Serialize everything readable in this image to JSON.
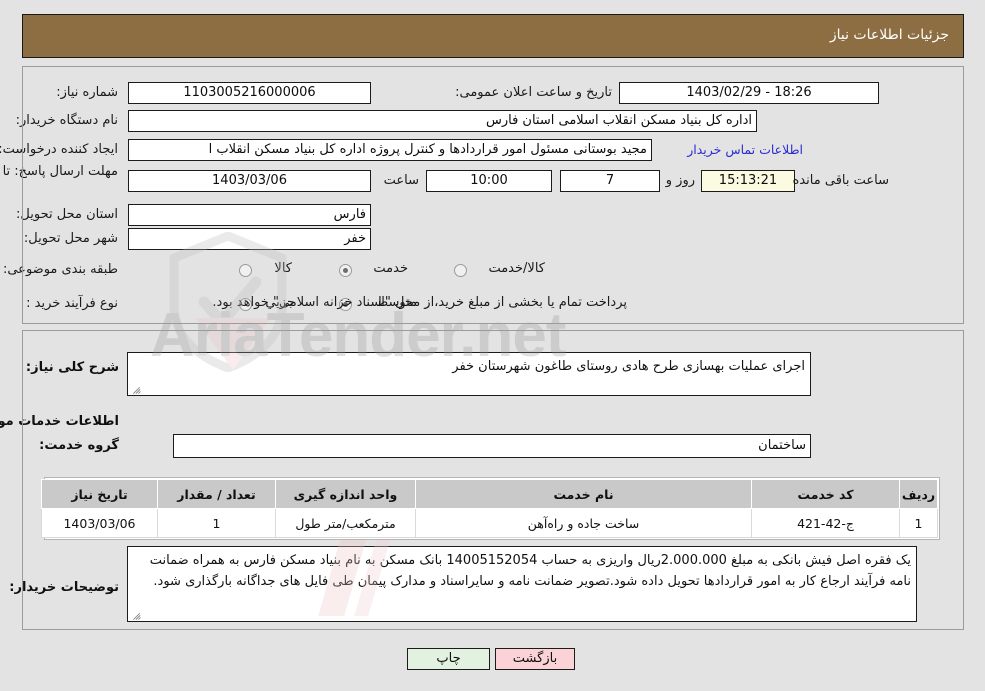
{
  "header": {
    "title": "جزئیات اطلاعات نیاز"
  },
  "form": {
    "need_number_label": "شماره نیاز:",
    "need_number_value": "1103005216000006",
    "announce_label": "تاریخ و ساعت اعلان عمومی:",
    "announce_value": "18:26 - 1403/02/29",
    "buyer_org_label": "نام دستگاه خریدار:",
    "buyer_org_value": "اداره کل بنیاد مسکن انقلاب اسلامی استان فارس",
    "creator_label": "ایجاد کننده درخواست:",
    "creator_value": "مجید بوستانی مسئول امور قراردادها و کنترل پروژه اداره کل بنیاد مسکن انقلاب ا",
    "contact_link": "اطلاعات تماس خریدار",
    "deadline_label": "مهلت ارسال پاسخ: تا تاریخ:",
    "deadline_date": "1403/03/06",
    "hour_label": "ساعت",
    "hour_value": "10:00",
    "days_value": "7",
    "days_label": "روز و",
    "timer_value": "15:13:21",
    "remaining_label": "ساعت باقی مانده",
    "province_label": "استان محل تحویل:",
    "province_value": "فارس",
    "city_label": "شهر محل تحویل:",
    "city_value": "خفر",
    "category_label": "طبقه بندی موضوعی:",
    "category_options": [
      {
        "label": "کالا",
        "selected": false
      },
      {
        "label": "خدمت",
        "selected": true
      },
      {
        "label": "کالا/خدمت",
        "selected": false
      }
    ],
    "process_label": "نوع فرآیند خرید :",
    "process_options": [
      {
        "label": "جزیي",
        "selected": false
      },
      {
        "label": "متوسط",
        "selected": true
      }
    ],
    "treasury_note": "پرداخت تمام یا بخشی از مبلغ خرید،از محل \"اسناد خزانه اسلامی\" خواهد بود."
  },
  "lower": {
    "general_desc_label": "شرح کلی نیاز:",
    "general_desc_value": "اجرای عملیات بهسازی طرح هادی روستای طاغون شهرستان خفر",
    "services_section_title": "اطلاعات خدمات مورد نیاز",
    "service_group_label": "گروه خدمت:",
    "service_group_value": "ساختمان",
    "buyer_notes_label": "توضیحات خریدار:",
    "buyer_notes_value": "یک فقره اصل فیش بانکی به مبلغ 2.000.000ریال واریزی به حساب 14005152054 بانک مسکن به نام بنیاد مسکن فارس به همراه ضمانت نامه فرآیند ارجاع کار به امور قراردادها تحویل داده شود.تصویر ضمانت نامه و سایراسناد و مدارک پیمان طی فایل های جداگانه بارگذاری شود."
  },
  "table": {
    "columns": [
      "ردیف",
      "کد خدمت",
      "نام خدمت",
      "واحد اندازه گیری",
      "تعداد / مقدار",
      "تاریخ نیاز"
    ],
    "rows": [
      {
        "index": "1",
        "service_code": "ج-42-421",
        "service_name": "ساخت جاده و راه‌آهن",
        "unit": "مترمکعب/متر طول",
        "quantity": "1",
        "need_date": "1403/03/06"
      }
    ]
  },
  "footer": {
    "print_label": "چاپ",
    "back_label": "بازگشت"
  },
  "watermark": {
    "text": "AriaTender.net"
  },
  "colors": {
    "header_bg": "#8d6e42",
    "link": "#2b2bd0",
    "print_btn": "#e3f2e0",
    "back_btn": "#fbd3d6",
    "timer_bg": "#fbfbe2",
    "page_bg": "#e3e3e3",
    "table_header_bg": "#c9c9c9"
  }
}
